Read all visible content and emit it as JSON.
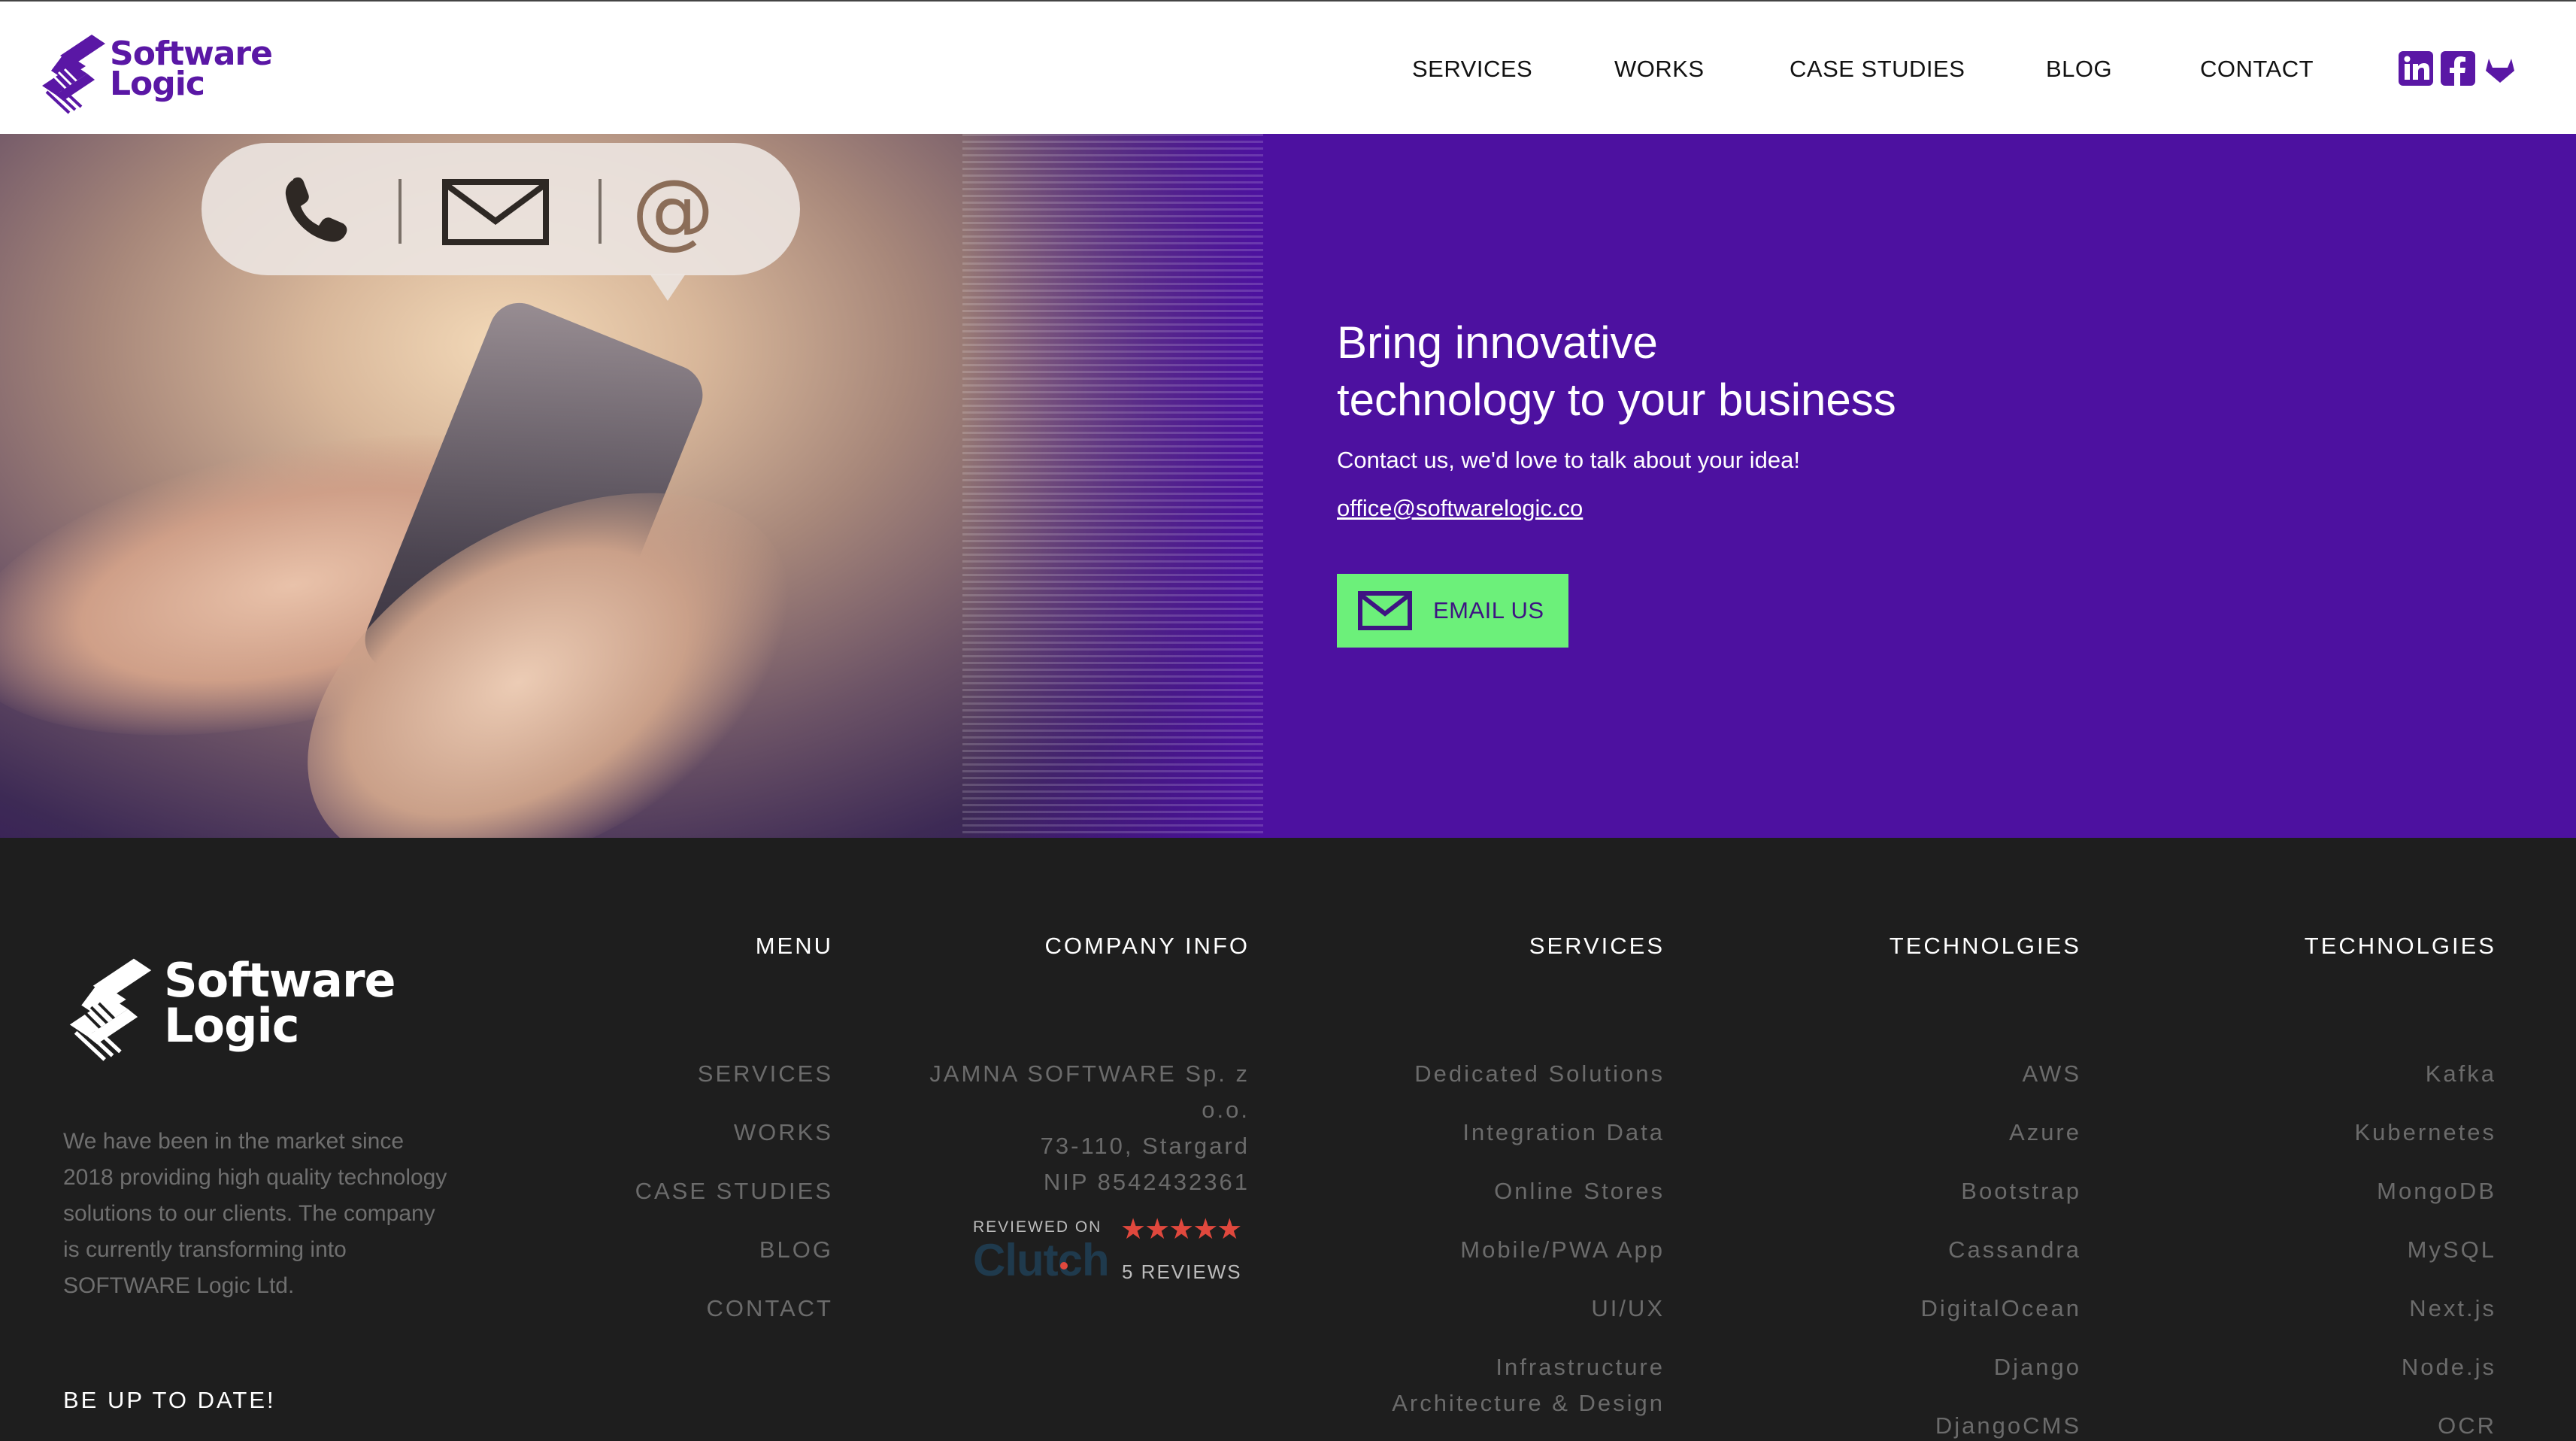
{
  "header": {
    "logo_line1": "Software",
    "logo_line2": "Logic",
    "nav": [
      {
        "label": "SERVICES"
      },
      {
        "label": "WORKS"
      },
      {
        "label": "CASE STUDIES"
      },
      {
        "label": "BLOG"
      },
      {
        "label": "CONTACT"
      }
    ],
    "social_icons": [
      "linkedin-icon",
      "facebook-icon",
      "gitlab-icon"
    ],
    "brand_color": "#5a17a5"
  },
  "hero": {
    "title_line1": "Bring innovative",
    "title_line2": "technology to your business",
    "subtitle": "Contact us, we'd love to talk about your idea!",
    "email": "office@softwarelogic.co",
    "button_label": "EMAIL US",
    "bg_color": "#4d11a0",
    "button_color": "#6cf07a",
    "image_icons": [
      "phone-icon",
      "envelope-icon",
      "at-sign-icon"
    ]
  },
  "footer": {
    "logo_line1": "Software",
    "logo_line2": "Logic",
    "about": "We have been in the market since 2018 providing high quality technology solutions to our clients. The company is currently transforming into SOFTWARE Logic Ltd.",
    "update_title": "BE UP TO DATE!",
    "menu": {
      "title": "MENU",
      "items": [
        "SERVICES",
        "WORKS",
        "CASE STUDIES",
        "BLOG",
        "CONTACT"
      ]
    },
    "company": {
      "title": "COMPANY INFO",
      "line1": "JAMNA SOFTWARE Sp. z",
      "line2": "o.o.",
      "line3": "73-110, Stargard",
      "line4": "NIP 8542432361"
    },
    "clutch": {
      "reviewed_on": "REVIEWED ON",
      "brand": "Clutch",
      "stars": "★★★★★",
      "reviews": "5 REVIEWS"
    },
    "services": {
      "title": "SERVICES",
      "items": [
        "Dedicated Solutions",
        "Integration Data",
        "Online Stores",
        "Mobile/PWA App",
        "UI/UX",
        "Infrastructure",
        "Architecture & Design"
      ]
    },
    "tech1": {
      "title": "TECHNOLGIES",
      "items": [
        "AWS",
        "Azure",
        "Bootstrap",
        "Cassandra",
        "DigitalOcean",
        "Django",
        "DjangoCMS"
      ]
    },
    "tech2": {
      "title": "TECHNOLGIES",
      "items": [
        "Kafka",
        "Kubernetes",
        "MongoDB",
        "MySQL",
        "Next.js",
        "Node.js",
        "OCR"
      ]
    }
  }
}
